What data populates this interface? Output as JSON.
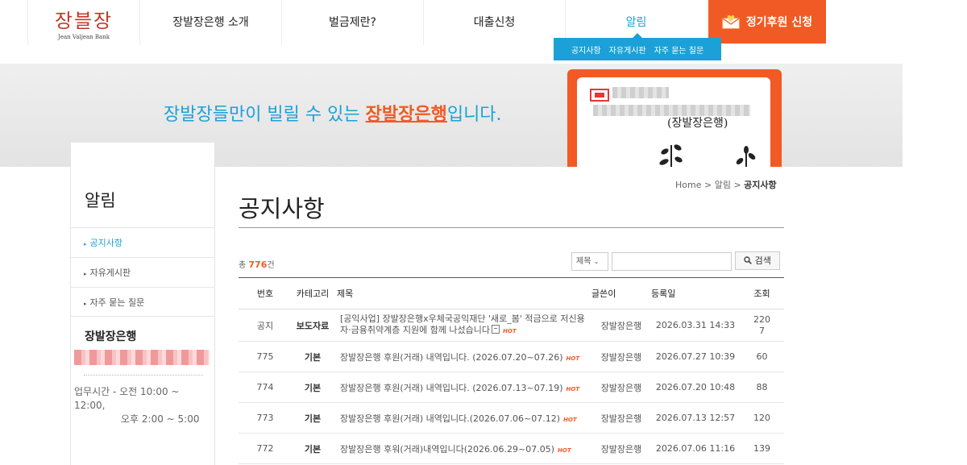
{
  "header": {
    "logo": {
      "main": "장블장",
      "sub": "Jean Valjean Bank"
    },
    "nav": [
      {
        "label": "장발장은행 소개"
      },
      {
        "label": "벌금제란?"
      },
      {
        "label": "대출신청"
      },
      {
        "label": "알림"
      }
    ],
    "active_nav": "알림",
    "donate_label": "정기후원 신청",
    "subnav": [
      {
        "label": "공지사항"
      },
      {
        "label": "자유게시판"
      },
      {
        "label": "자주 묻는 질문"
      }
    ]
  },
  "banner": {
    "text_before": "장발장들만이 빌릴 수 있는 ",
    "highlight": "장발장은행",
    "text_after": "입니다.",
    "card_text": "(장발장은행)"
  },
  "sidebar": {
    "title": "알림",
    "items": [
      {
        "label": "공지사항",
        "active": true
      },
      {
        "label": "자유게시판",
        "active": false
      },
      {
        "label": "자주 묻는 질문",
        "active": false
      }
    ],
    "bank_name": "장발장은행",
    "hours_line1": "업무시간 - 오전 10:00 ~ 12:00,",
    "hours_line2": "오후 2:00 ~ 5:00"
  },
  "breadcrumb": {
    "home": "Home",
    "section": "알림",
    "current": "공지사항"
  },
  "page_title": "공지사항",
  "list": {
    "count_prefix": "총 ",
    "count": "776",
    "count_suffix": "건",
    "search_select": "제목",
    "search_button": "검색"
  },
  "table": {
    "headers": {
      "no": "번호",
      "category": "카테고리",
      "title": "제목",
      "author": "글쓴이",
      "date": "등록일",
      "views": "조회"
    },
    "rows": [
      {
        "no": "공지",
        "category": "보도자료",
        "title": "[공익사업] 장발장은행x우체국공익재단 '새로_봄' 적금으로 저신용자·금융취약계층 지원에 함께 나섰습니다",
        "attachment": true,
        "hot": "HOT",
        "author": "장발장은행",
        "date": "2026.03.31 14:33",
        "views": "2207"
      },
      {
        "no": "775",
        "category": "기본",
        "title": "장발장은행 후원(거래) 내역입니다. (2026.07.20~07.26)",
        "hot": "HOT",
        "author": "장발장은행",
        "date": "2026.07.27 10:39",
        "views": "60"
      },
      {
        "no": "774",
        "category": "기본",
        "title": "장발장은행 후원(거래) 내역입니다. (2026.07.13~07.19)",
        "hot": "HOT",
        "author": "장발장은행",
        "date": "2026.07.20 10:48",
        "views": "88"
      },
      {
        "no": "773",
        "category": "기본",
        "title": "장발장은행 후원(거래) 내역입니다.(2026.07.06~07.12)",
        "hot": "HOT",
        "author": "장발장은행",
        "date": "2026.07.13 12:57",
        "views": "120"
      },
      {
        "no": "772",
        "category": "기본",
        "title": "장발장은행 후워(거래)내역입니다(2026.06.29~07.05)",
        "hot": "HOT",
        "author": "장발장은행",
        "date": "2026.07.06 11:16",
        "views": "139"
      }
    ]
  },
  "colors": {
    "accent": "#1ba1d7",
    "brand": "#f15a24"
  },
  "icons": {
    "donate": "envelope-heart-icon",
    "search": "search-icon",
    "attachment": "file-icon"
  }
}
